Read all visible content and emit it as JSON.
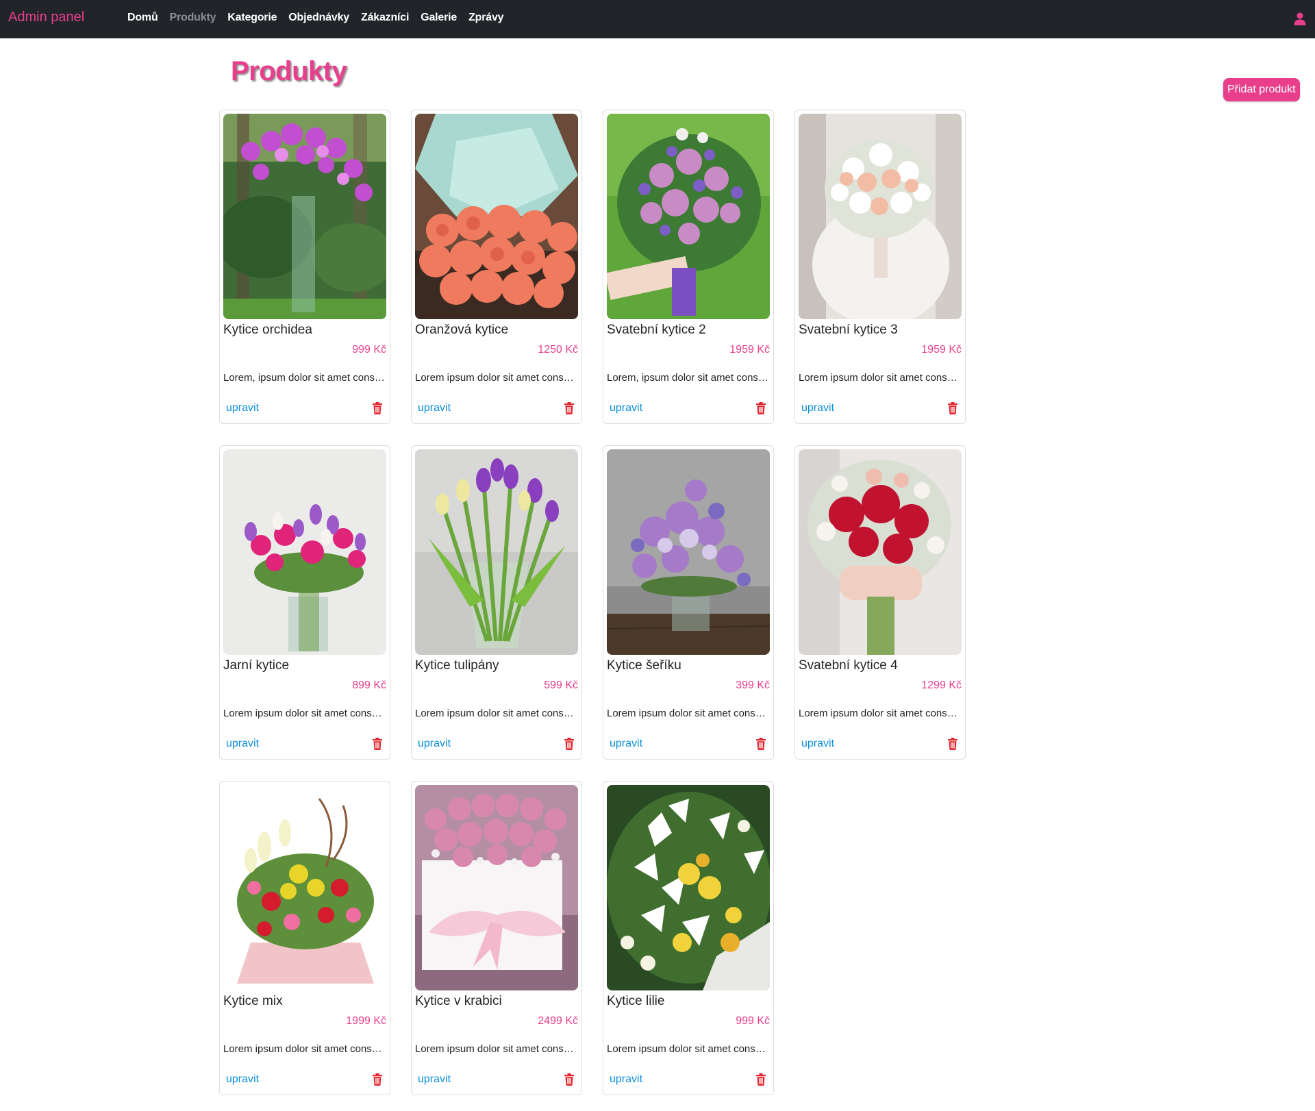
{
  "navbar": {
    "brand": "Admin panel",
    "links": [
      {
        "label": "Domů",
        "active": false
      },
      {
        "label": "Produkty",
        "active": true
      },
      {
        "label": "Kategorie",
        "active": false
      },
      {
        "label": "Objednávky",
        "active": false
      },
      {
        "label": "Zákazníci",
        "active": false
      },
      {
        "label": "Galerie",
        "active": false
      },
      {
        "label": "Zprávy",
        "active": false
      }
    ],
    "user_icon": "user-icon"
  },
  "page": {
    "title": "Produkty",
    "add_button_label": "Přidat produkt"
  },
  "colors": {
    "accent": "#e83e8c",
    "navbar_bg": "#212529",
    "link": "#0d8fdc",
    "delete": "#e3262d"
  },
  "products": [
    {
      "name": "Kytice orchidea",
      "price": "999 Kč",
      "description": "Lorem, ipsum dolor sit amet consectetur adipisicing elit.",
      "edit_label": "upravit",
      "image": "orchid-bouquet-photo"
    },
    {
      "name": "Oranžová kytice",
      "price": "1250 Kč",
      "description": "Lorem ipsum dolor sit amet consectetur adipisicing elit.",
      "edit_label": "upravit",
      "image": "orange-roses-photo"
    },
    {
      "name": "Svatební kytice 2",
      "price": "1959 Kč",
      "description": "Lorem, ipsum dolor sit amet consectetur adipisicing elit.",
      "edit_label": "upravit",
      "image": "wedding-bouquet-purple-photo"
    },
    {
      "name": "Svatební kytice 3",
      "price": "1959 Kč",
      "description": "Lorem ipsum dolor sit amet consectetur adipisicing elit.",
      "edit_label": "upravit",
      "image": "wedding-bouquet-white-photo"
    },
    {
      "name": "Jarní kytice",
      "price": "899 Kč",
      "description": "Lorem ipsum dolor sit amet consectetur adipisicing elit.",
      "edit_label": "upravit",
      "image": "spring-bouquet-photo"
    },
    {
      "name": "Kytice tulipány",
      "price": "599 Kč",
      "description": "Lorem ipsum dolor sit amet consectetur adipisicing elit.",
      "edit_label": "upravit",
      "image": "tulips-vase-photo"
    },
    {
      "name": "Kytice šeříku",
      "price": "399 Kč",
      "description": "Lorem ipsum dolor sit amet consectetur adipisicing elit.",
      "edit_label": "upravit",
      "image": "lilac-vase-photo"
    },
    {
      "name": "Svatební kytice 4",
      "price": "1299 Kč",
      "description": "Lorem ipsum dolor sit amet consectetur adipisicing elit.",
      "edit_label": "upravit",
      "image": "wedding-bouquet-red-photo"
    },
    {
      "name": "Kytice mix",
      "price": "1999 Kč",
      "description": "Lorem ipsum dolor sit amet consectetur adipisicing elit.",
      "edit_label": "upravit",
      "image": "mixed-bouquet-photo"
    },
    {
      "name": "Kytice v krabici",
      "price": "2499 Kč",
      "description": "Lorem ipsum dolor sit amet consectetur adipisicing elit.",
      "edit_label": "upravit",
      "image": "roses-box-photo"
    },
    {
      "name": "Kytice lilie",
      "price": "999 Kč",
      "description": "Lorem ipsum dolor sit amet consectetur adipisicing elit.",
      "edit_label": "upravit",
      "image": "lilies-bouquet-photo"
    }
  ]
}
